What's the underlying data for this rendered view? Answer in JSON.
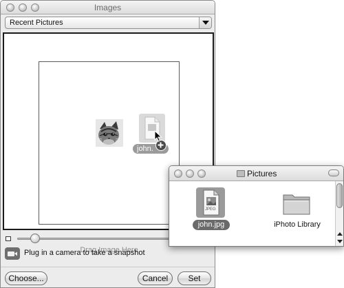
{
  "images_window": {
    "title": "Images",
    "source_popup": {
      "selected": "Recent Pictures"
    },
    "drop_hint": "Drag Image Here",
    "drag_ghost_label": "john.",
    "camera_text": "Plug in a camera to take a snapshot",
    "buttons": {
      "choose": "Choose...",
      "cancel": "Cancel",
      "set": "Set"
    },
    "zoom_slider": {
      "value": 0.07
    }
  },
  "pictures_window": {
    "title": "Pictures",
    "items": [
      {
        "label": "john.jpg",
        "selected": true,
        "icon": "jpeg-file-icon",
        "badge": "JPEG"
      },
      {
        "label": "iPhoto Library",
        "selected": false,
        "icon": "folder-icon"
      }
    ]
  },
  "icons": {
    "title_folder": "folder-icon",
    "camera": "video-camera-icon",
    "slider_min": "small-picture-icon",
    "cursor": "arrow-cursor-icon",
    "copy_badge": "plus-badge-icon"
  }
}
